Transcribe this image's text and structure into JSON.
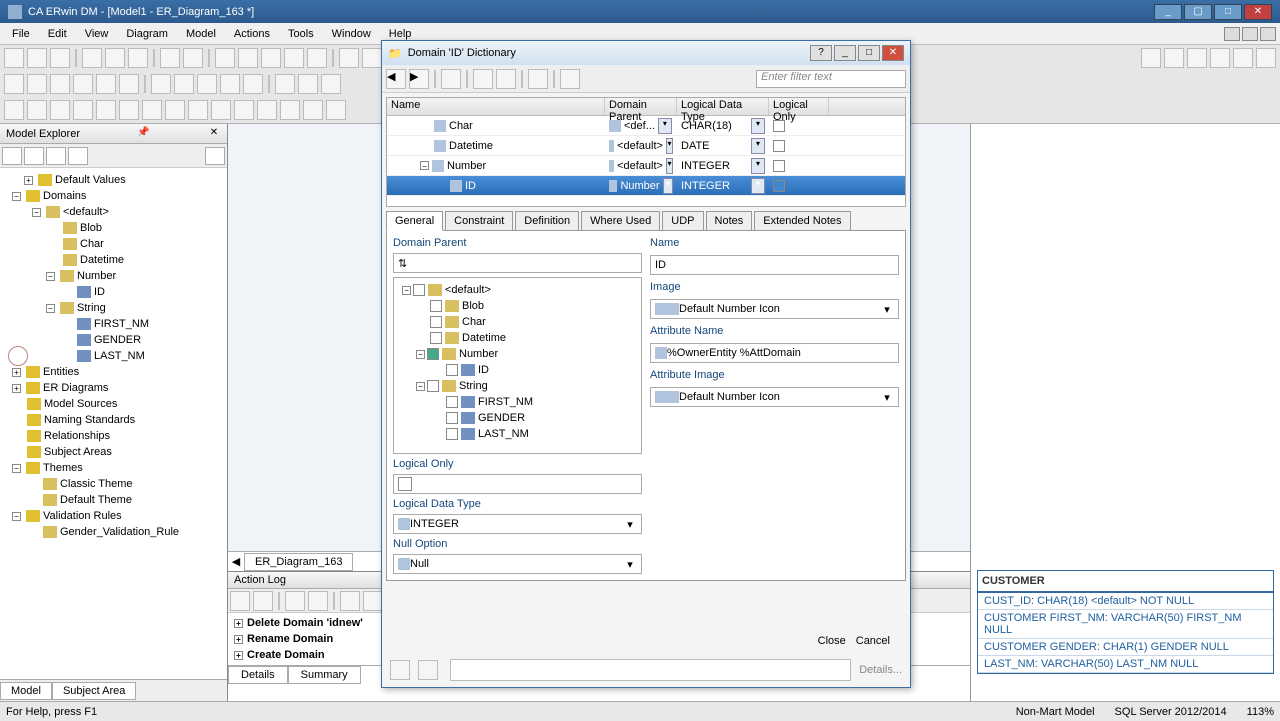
{
  "window": {
    "title": "CA ERwin DM - [Model1 - ER_Diagram_163 *]"
  },
  "menubar": {
    "items": [
      "File",
      "Edit",
      "View",
      "Diagram",
      "Model",
      "Actions",
      "Tools",
      "Window",
      "Help"
    ]
  },
  "model_explorer": {
    "title": "Model Explorer",
    "tree": {
      "default_values": "Default Values",
      "domains": "Domains",
      "default": "<default>",
      "blob": "Blob",
      "char": "Char",
      "datetime": "Datetime",
      "number": "Number",
      "id": "ID",
      "string": "String",
      "first_nm": "FIRST_NM",
      "gender": "GENDER",
      "last_nm": "LAST_NM",
      "entities": "Entities",
      "er_diagrams": "ER Diagrams",
      "model_sources": "Model Sources",
      "naming_standards": "Naming Standards",
      "relationships": "Relationships",
      "subject_areas": "Subject Areas",
      "themes": "Themes",
      "classic_theme": "Classic Theme",
      "default_theme": "Default Theme",
      "validation_rules": "Validation Rules",
      "gender_rule": "Gender_Validation_Rule"
    },
    "tabs": {
      "model": "Model",
      "subject_area": "Subject Area"
    }
  },
  "canvas_entity": {
    "title": "CUSTOMER",
    "pk": "CUST_ID: CHAR(",
    "r1": "CUSTOMER FIRS",
    "r2": "CUSTOMER GEN",
    "r3": "LAST_NM: VARC"
  },
  "diagram_tab": "ER_Diagram_163",
  "action_log": {
    "title": "Action Log",
    "items": {
      "a1": "Delete Domain 'idnew'",
      "a2": "Rename Domain",
      "a3": "Create Domain"
    },
    "tabs": {
      "details": "Details",
      "summary": "Summary"
    }
  },
  "dialog": {
    "title": "Domain 'ID' Dictionary",
    "filter_placeholder": "Enter filter text",
    "cols": {
      "name": "Name",
      "parent": "Domain Parent",
      "ldt": "Logical Data Type",
      "lo": "Logical Only"
    },
    "rows": {
      "r1": {
        "name": "Char",
        "parent": "<def...",
        "ldt": "CHAR(18)"
      },
      "r2": {
        "name": "Datetime",
        "parent": "<default>",
        "ldt": "DATE"
      },
      "r3": {
        "name": "Number",
        "parent": "<default>",
        "ldt": "INTEGER"
      },
      "r4": {
        "name": "ID",
        "parent": "Number",
        "ldt": "INTEGER"
      }
    },
    "tabs": {
      "general": "General",
      "constraint": "Constraint",
      "definition": "Definition",
      "where": "Where Used",
      "udp": "UDP",
      "notes": "Notes",
      "ext": "Extended Notes"
    },
    "labels": {
      "domain_parent": "Domain Parent",
      "name": "Name",
      "image": "Image",
      "attr_name": "Attribute Name",
      "attr_image": "Attribute Image",
      "logical_only": "Logical Only",
      "logical_data_type": "Logical Data Type",
      "null_option": "Null Option"
    },
    "values": {
      "name": "ID",
      "image": "Default Number Icon",
      "attr_name": "%OwnerEntity %AttDomain",
      "attr_image": "Default Number Icon",
      "ldt": "INTEGER",
      "null": "Null"
    },
    "dp_tree": {
      "default": "<default>",
      "blob": "Blob",
      "char": "Char",
      "datetime": "Datetime",
      "number": "Number",
      "id": "ID",
      "string": "String",
      "first": "FIRST_NM",
      "gender": "GENDER",
      "last": "LAST_NM"
    },
    "buttons": {
      "close": "Close",
      "cancel": "Cancel",
      "details": "Details..."
    }
  },
  "right_entity": {
    "title": "CUSTOMER",
    "r1": "CUST_ID: CHAR(18) <default> NOT NULL",
    "r2": "CUSTOMER FIRST_NM: VARCHAR(50) FIRST_NM NULL",
    "r3": "CUSTOMER GENDER: CHAR(1) GENDER NULL",
    "r4": "LAST_NM: VARCHAR(50) LAST_NM NULL"
  },
  "status": {
    "help": "For Help, press F1",
    "model": "Non-Mart Model",
    "db": "SQL Server 2012/2014",
    "zoom": "113%"
  }
}
